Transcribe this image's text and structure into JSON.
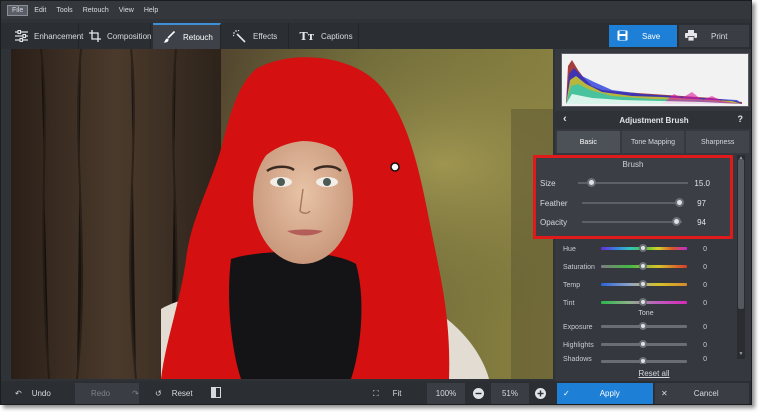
{
  "menu": [
    "File",
    "Edit",
    "Tools",
    "Retouch",
    "View",
    "Help"
  ],
  "tabs": [
    {
      "label": "Enhancement",
      "icon": "sliders-icon"
    },
    {
      "label": "Composition",
      "icon": "crop-icon"
    },
    {
      "label": "Retouch",
      "icon": "brush-icon",
      "active": true
    },
    {
      "label": "Effects",
      "icon": "magic-wand-icon"
    },
    {
      "label": "Captions",
      "icon": "text-icon"
    }
  ],
  "header_buttons": {
    "save": "Save",
    "print": "Print"
  },
  "panel": {
    "title": "Adjustment Brush",
    "help": "?",
    "subtabs": [
      "Basic",
      "Tone Mapping",
      "Sharpness"
    ],
    "brush": {
      "section": "Brush",
      "size": {
        "label": "Size",
        "value": "15.0",
        "level": 0.12
      },
      "feather": {
        "label": "Feather",
        "value": "97",
        "level": 0.97
      },
      "opacity": {
        "label": "Opacity",
        "value": "94",
        "level": 0.94
      }
    },
    "color_rows": [
      {
        "label": "Hue",
        "value": "0"
      },
      {
        "label": "Saturation",
        "value": "0"
      },
      {
        "label": "Temp",
        "value": "0"
      },
      {
        "label": "Tint",
        "value": "0"
      }
    ],
    "tone_section": "Tone",
    "tone_rows": [
      {
        "label": "Exposure",
        "value": "0"
      },
      {
        "label": "Highlights",
        "value": "0"
      },
      {
        "label": "Shadows",
        "value": "0"
      }
    ],
    "reset_all": "Reset all"
  },
  "bottom": {
    "undo": "Undo",
    "redo": "Redo",
    "reset": "Reset",
    "fit": "Fit",
    "zoom_100": "100%",
    "zoom_value": "51%",
    "apply": "Apply",
    "cancel": "Cancel"
  },
  "colors": {
    "accent": "#1e7fd6",
    "highlight_box": "#e01a1a",
    "brush_mask": "#d41010"
  }
}
